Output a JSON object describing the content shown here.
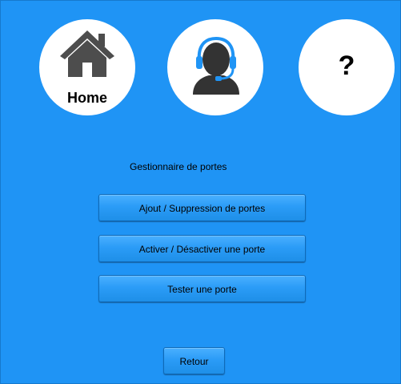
{
  "nav": {
    "home_label": "Home",
    "help_glyph": "?"
  },
  "icons": {
    "home": "house-icon",
    "support": "headset-support-icon"
  },
  "colors": {
    "background": "#1f94f5",
    "button": "#2b9cf7",
    "icon": "#4d4d4d",
    "headset_accent": "#1f94f5"
  },
  "main": {
    "title": "Gestionnaire de portes",
    "buttons": {
      "add_remove": "Ajout / Suppression de portes",
      "enable_disable": "Activer / Désactiver une porte",
      "test": "Tester une porte"
    },
    "back": "Retour"
  }
}
